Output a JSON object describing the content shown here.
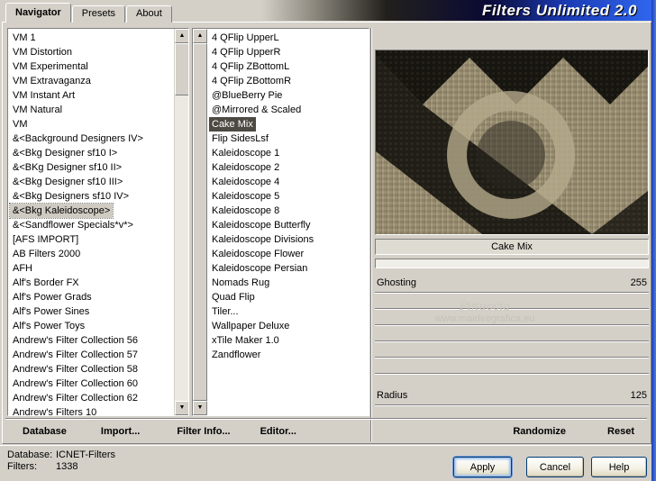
{
  "window": {
    "title": "Filters Unlimited 2.0",
    "tabs": [
      {
        "label": "Navigator",
        "active": true
      },
      {
        "label": "Presets",
        "active": false
      },
      {
        "label": "About",
        "active": false
      }
    ]
  },
  "icons": {
    "scroll_up": "▲",
    "scroll_down": "▼"
  },
  "categories": {
    "selected": "&<Bkg Kaleidoscope>",
    "items": [
      "VM 1",
      "VM Distortion",
      "VM Experimental",
      "VM Extravaganza",
      "VM Instant Art",
      "VM Natural",
      "VM",
      "&<Background Designers IV>",
      "&<Bkg Designer sf10 I>",
      "&<BKg Designer sf10 II>",
      "&<Bkg Designer sf10 III>",
      "&<Bkg Designers sf10 IV>",
      "&<Bkg Kaleidoscope>",
      "&<Sandflower Specials*v*>",
      "[AFS IMPORT]",
      "AB Filters 2000",
      "AFH",
      "Alf's Border FX",
      "Alf's Power Grads",
      "Alf's Power Sines",
      "Alf's Power Toys",
      "Andrew's Filter Collection 56",
      "Andrew's Filter Collection 57",
      "Andrew's Filter Collection 58",
      "Andrew's Filter Collection 60",
      "Andrew's Filter Collection 62",
      "Andrew's Filters 10"
    ]
  },
  "filters": {
    "selected": "Cake Mix",
    "items": [
      "4 QFlip UpperL",
      "4 QFlip UpperR",
      "4 QFlip ZBottomL",
      "4 QFlip ZBottomR",
      "@BlueBerry Pie",
      "@Mirrored & Scaled",
      "Cake Mix",
      "Flip SidesLsf",
      "Kaleidoscope 1",
      "Kaleidoscope 2",
      "Kaleidoscope 4",
      "Kaleidoscope 5",
      "Kaleidoscope 8",
      "Kaleidoscope Butterfly",
      "Kaleidoscope Divisions",
      "Kaleidoscope Flower",
      "Kaleidoscope Persian",
      "Nomads Rug",
      "Quad Flip",
      "Tiler...",
      "Wallpaper Deluxe",
      "xTile Maker 1.0",
      "Zandflower"
    ]
  },
  "preview": {
    "selected_filter": "Cake Mix",
    "watermark": [
      "Pinuccia",
      "www.maidiregrafica.eu"
    ]
  },
  "controls": {
    "rows": [
      {
        "label": "Ghosting",
        "value": "255"
      },
      {
        "label": "",
        "value": ""
      },
      {
        "label": "",
        "value": ""
      },
      {
        "label": "",
        "value": ""
      },
      {
        "label": "",
        "value": ""
      },
      {
        "label": "",
        "value": ""
      },
      {
        "label": "Radius",
        "value": "125"
      }
    ]
  },
  "toolbar": {
    "left": [
      "Database",
      "Import...",
      "Filter Info...",
      "Editor..."
    ],
    "right": [
      "Randomize",
      "Reset"
    ]
  },
  "status": {
    "database_label": "Database:",
    "database_value": "ICNET-Filters",
    "filters_label": "Filters:",
    "filters_value": "1338"
  },
  "actions": {
    "apply": "Apply",
    "cancel": "Cancel",
    "help": "Help"
  },
  "colors": {
    "banner_blue": "#2f66ee",
    "selection_dark": "#4d4a44",
    "selection_light": "#cfcbc2",
    "preview_tan": "#a89d7f",
    "preview_dark": "#17150f"
  }
}
